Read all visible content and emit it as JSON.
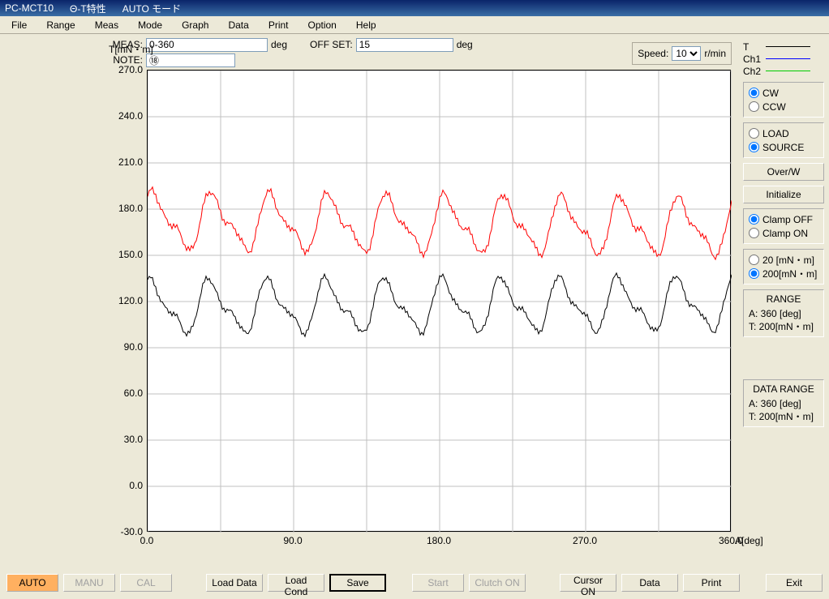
{
  "title": {
    "app": "PC-MCT10",
    "mode": "Θ-T特性",
    "auto": "AUTO モード"
  },
  "menu": [
    "File",
    "Range",
    "Meas",
    "Mode",
    "Graph",
    "Data",
    "Print",
    "Option",
    "Help"
  ],
  "top": {
    "meas_label": "MEAS:",
    "meas_value": "0-360",
    "meas_unit": "deg",
    "offset_label": "OFF SET:",
    "offset_value": "15",
    "offset_unit": "deg",
    "note_label": "NOTE:",
    "note_value": "⑱"
  },
  "speed": {
    "label": "Speed:",
    "value": "10",
    "unit": "r/min"
  },
  "legend": {
    "t": "T",
    "ch1": "Ch1",
    "ch2": "Ch2"
  },
  "dir": {
    "cw": "CW",
    "ccw": "CCW",
    "sel": "cw"
  },
  "ls": {
    "load": "LOAD",
    "source": "SOURCE",
    "sel": "source"
  },
  "buttons_side": {
    "overw": "Over/W",
    "init": "Initialize"
  },
  "clamp": {
    "off": "Clamp OFF",
    "on": "Clamp ON",
    "sel": "off"
  },
  "scale": {
    "a": "20 [mN・m]",
    "b": "200[mN・m]",
    "sel": "b"
  },
  "range": {
    "title": "RANGE",
    "a": "A: 360 [deg]",
    "t": "T: 200[mN・m]"
  },
  "drange": {
    "title": "DATA RANGE",
    "a": "A: 360 [deg]",
    "t": "T: 200[mN・m]"
  },
  "axis": {
    "ylabel": "T[mN・m]",
    "xlabel": "A[deg]",
    "yticks": [
      "270.0",
      "240.0",
      "210.0",
      "180.0",
      "150.0",
      "120.0",
      "90.0",
      "60.0",
      "30.0",
      "0.0",
      "-30.0"
    ],
    "xticks": [
      "0.0",
      "90.0",
      "180.0",
      "270.0",
      "360.0"
    ]
  },
  "bottom": {
    "auto": "AUTO",
    "manu": "MANU",
    "cal": "CAL",
    "loaddata": "Load Data",
    "loadcond": "Load Cond",
    "save": "Save",
    "start": "Start",
    "clutch": "Clutch ON",
    "cursor": "Cursor ON",
    "data": "Data",
    "print": "Print",
    "exit": "Exit"
  },
  "chart_data": {
    "type": "line",
    "xlabel": "A[deg]",
    "ylabel": "T[mN・m]",
    "xlim": [
      0,
      360
    ],
    "ylim": [
      -30,
      270
    ],
    "series": [
      {
        "name": "T",
        "color": "#000000",
        "x": [
          0,
          10,
          20,
          30,
          40,
          50,
          60,
          70,
          80,
          90,
          100,
          110,
          120,
          130,
          140,
          150,
          160,
          170,
          180,
          190,
          200,
          210,
          220,
          230,
          240,
          250,
          260,
          270,
          280,
          290,
          300,
          310,
          320,
          330,
          340,
          350,
          360
        ],
        "values": [
          120,
          118,
          124,
          132,
          110,
          102,
          126,
          134,
          108,
          100,
          128,
          136,
          110,
          100,
          127,
          135,
          112,
          98,
          126,
          134,
          108,
          96,
          130,
          138,
          110,
          100,
          132,
          138,
          112,
          98,
          128,
          136,
          110,
          100,
          126,
          134,
          120
        ]
      },
      {
        "name": "Ch2",
        "color": "#ff0000",
        "x": [
          0,
          10,
          20,
          30,
          40,
          50,
          60,
          70,
          80,
          90,
          100,
          110,
          120,
          130,
          140,
          150,
          160,
          170,
          180,
          190,
          200,
          210,
          220,
          230,
          240,
          250,
          260,
          270,
          280,
          290,
          300,
          310,
          320,
          330,
          340,
          350,
          360
        ],
        "values": [
          178,
          176,
          190,
          198,
          168,
          160,
          186,
          192,
          166,
          158,
          188,
          194,
          168,
          158,
          186,
          192,
          170,
          154,
          186,
          192,
          166,
          152,
          188,
          194,
          168,
          156,
          190,
          194,
          170,
          156,
          186,
          192,
          168,
          156,
          184,
          192,
          170
        ]
      }
    ]
  }
}
